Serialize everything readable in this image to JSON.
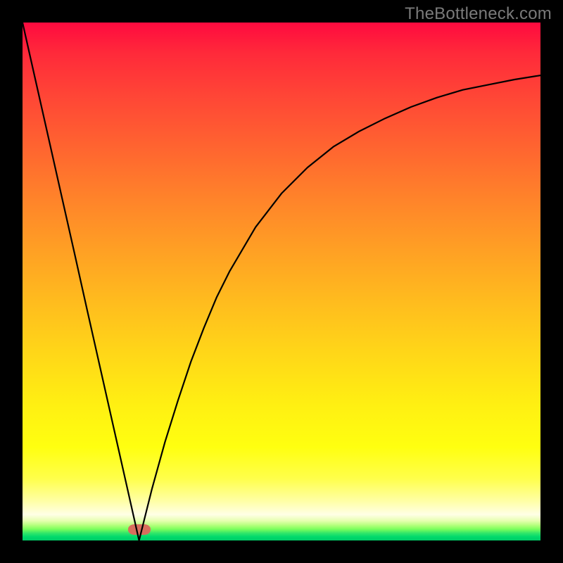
{
  "watermark": "TheBottleneck.com",
  "colors": {
    "frame": "#000000",
    "gradient_top": "#ff0a3f",
    "gradient_mid1": "#ff832a",
    "gradient_mid2": "#ffd718",
    "gradient_mid3": "#ffff4a",
    "gradient_bottom": "#00cc66",
    "curve": "#000000",
    "marker": "#d86e5d",
    "watermark_text": "#7a7a7a"
  },
  "chart_data": {
    "type": "line",
    "title": "",
    "xlabel": "",
    "ylabel": "",
    "xlim": [
      0,
      1
    ],
    "ylim": [
      0,
      1
    ],
    "annotations": [
      {
        "name": "minimum-marker",
        "x": 0.225,
        "y": 0.0
      }
    ],
    "series": [
      {
        "name": "bottleneck-curve",
        "x": [
          0.0,
          0.025,
          0.05,
          0.075,
          0.1,
          0.125,
          0.15,
          0.175,
          0.2,
          0.225,
          0.25,
          0.275,
          0.3,
          0.325,
          0.35,
          0.375,
          0.4,
          0.45,
          0.5,
          0.55,
          0.6,
          0.65,
          0.7,
          0.75,
          0.8,
          0.85,
          0.9,
          0.95,
          1.0
        ],
        "y": [
          1.0,
          0.889,
          0.778,
          0.667,
          0.556,
          0.444,
          0.333,
          0.222,
          0.111,
          0.0,
          0.1,
          0.19,
          0.27,
          0.345,
          0.41,
          0.47,
          0.52,
          0.605,
          0.67,
          0.72,
          0.76,
          0.79,
          0.815,
          0.837,
          0.855,
          0.87,
          0.88,
          0.89,
          0.898
        ]
      }
    ]
  }
}
